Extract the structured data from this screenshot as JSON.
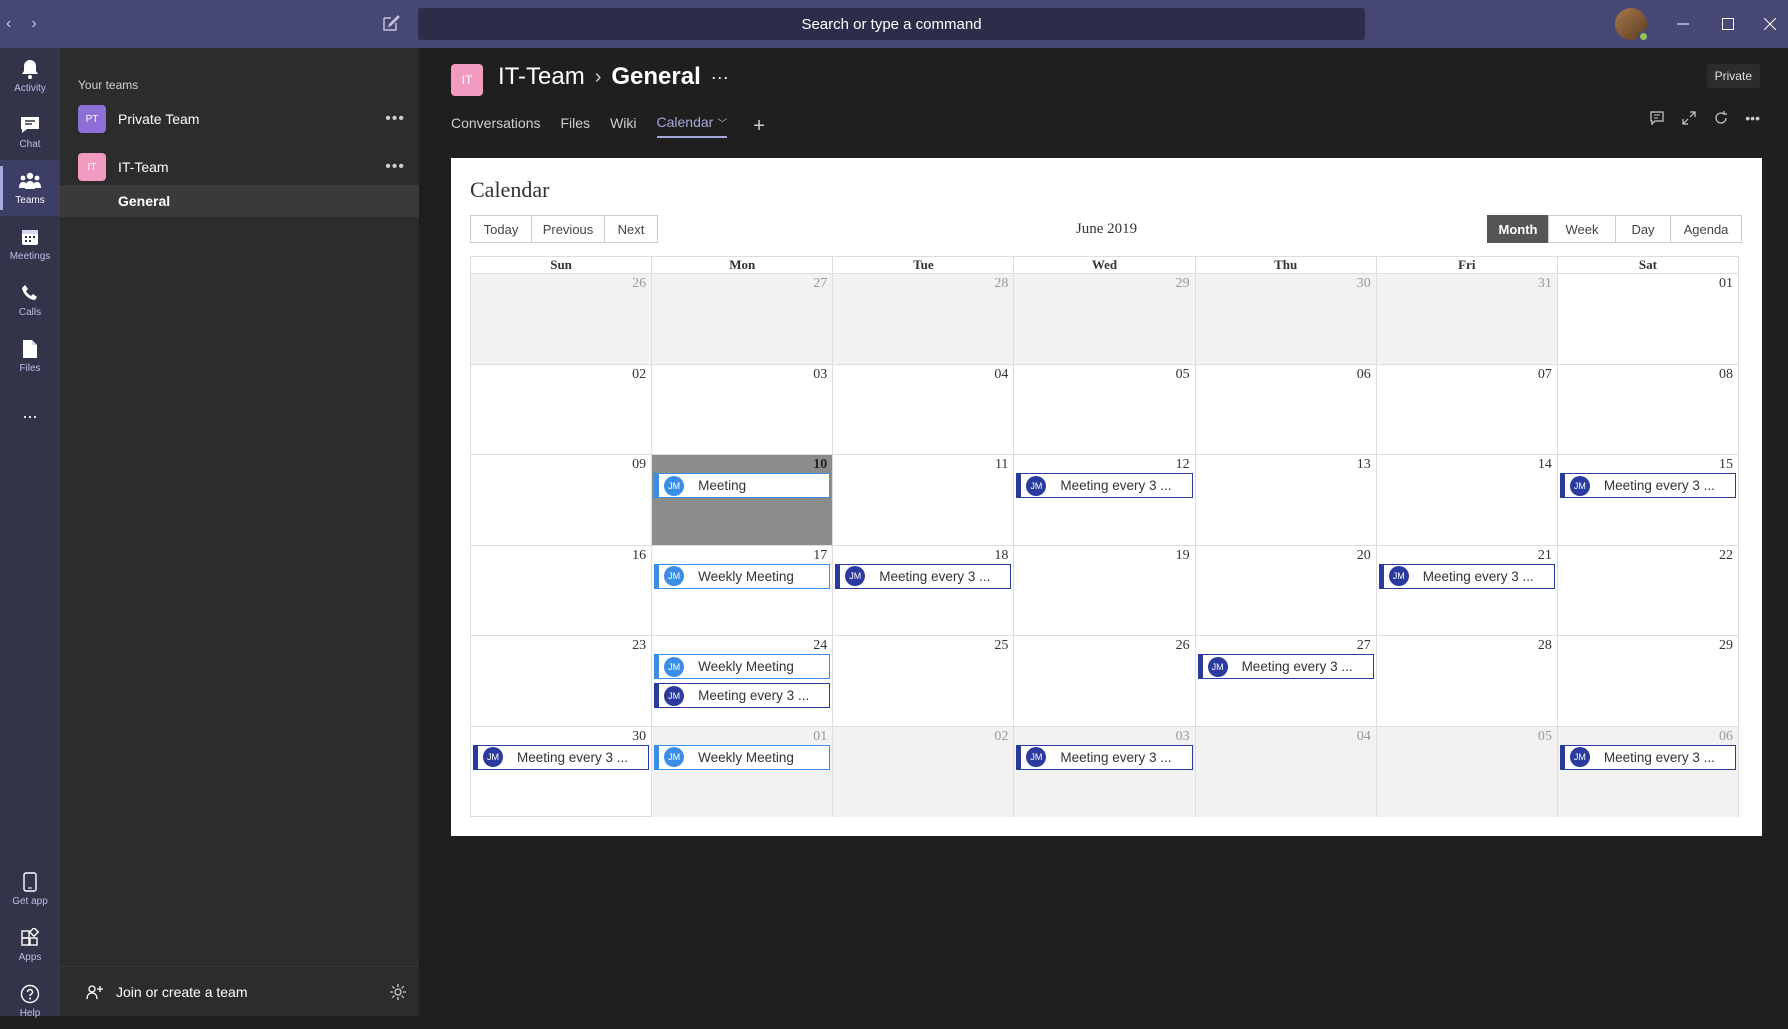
{
  "titlebar": {
    "search_placeholder": "Search or type a command",
    "back": "‹",
    "forward": "›"
  },
  "rail": {
    "items": [
      {
        "label": "Activity"
      },
      {
        "label": "Chat"
      },
      {
        "label": "Teams"
      },
      {
        "label": "Meetings"
      },
      {
        "label": "Calls"
      },
      {
        "label": "Files"
      },
      {
        "label": "..."
      },
      {
        "label": "Get app"
      },
      {
        "label": "Apps"
      },
      {
        "label": "Help"
      }
    ]
  },
  "teams_panel": {
    "heading": "Your teams",
    "teams": [
      {
        "initials": "PT",
        "name": "Private Team",
        "color": "#8e6fd8"
      },
      {
        "initials": "IT",
        "name": "IT-Team",
        "color": "#f29bc1"
      }
    ],
    "channel": "General",
    "join": "Join or create a team"
  },
  "header": {
    "avatar_initials": "IT",
    "team": "IT-Team",
    "channel": "General",
    "more": "···",
    "private": "Private",
    "tabs": [
      "Conversations",
      "Files",
      "Wiki",
      "Calendar"
    ],
    "active_tab": "Calendar"
  },
  "calendar": {
    "title": "Calendar",
    "nav": {
      "today": "Today",
      "previous": "Previous",
      "next": "Next"
    },
    "month_label": "June 2019",
    "views": {
      "month": "Month",
      "week": "Week",
      "day": "Day",
      "agenda": "Agenda"
    },
    "active_view": "Month",
    "weekdays": [
      "Sun",
      "Mon",
      "Tue",
      "Wed",
      "Thu",
      "Fri",
      "Sat"
    ],
    "weeks": [
      [
        "26",
        "27",
        "28",
        "29",
        "30",
        "31",
        "01"
      ],
      [
        "02",
        "03",
        "04",
        "05",
        "06",
        "07",
        "08"
      ],
      [
        "09",
        "10",
        "11",
        "12",
        "13",
        "14",
        "15"
      ],
      [
        "16",
        "17",
        "18",
        "19",
        "20",
        "21",
        "22"
      ],
      [
        "23",
        "24",
        "25",
        "26",
        "27",
        "28",
        "29"
      ],
      [
        "30",
        "01",
        "02",
        "03",
        "04",
        "05",
        "06"
      ]
    ],
    "event_initials": "JM",
    "events": {
      "meeting": "Meeting",
      "weekly": "Weekly Meeting",
      "every3": "Meeting every 3 ..."
    }
  }
}
